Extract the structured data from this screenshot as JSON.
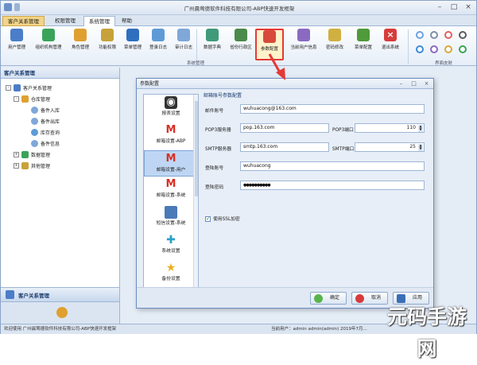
{
  "window": {
    "title": "广州晨莺德软件科技有限公司-ABP快速开发框架"
  },
  "tabs": [
    "客户关系管理",
    "权限管理",
    "系统管理",
    "帮助"
  ],
  "ribbon": {
    "buttons": [
      "用户管理",
      "组织机构管理",
      "角色管理",
      "功能权限",
      "菜单管理",
      "登录日志",
      "审计日志",
      "数据字典",
      "省份行政区",
      "参数配置",
      "当前用户信息",
      "密码修改",
      "菜单配置",
      "退出系统"
    ],
    "group_label": "系统管理",
    "skin_label": "界面皮肤"
  },
  "sidebar": {
    "header": "客户关系管理",
    "tree": [
      {
        "label": "客户关系管理",
        "level": 0,
        "expander": "-"
      },
      {
        "label": "仓库管理",
        "level": 1,
        "expander": "-"
      },
      {
        "label": "备件入库",
        "level": 2,
        "expander": ""
      },
      {
        "label": "备件出库",
        "level": 2,
        "expander": ""
      },
      {
        "label": "库存查询",
        "level": 2,
        "expander": ""
      },
      {
        "label": "备件信息",
        "level": 2,
        "expander": ""
      },
      {
        "label": "数据管理",
        "level": 1,
        "expander": "+"
      },
      {
        "label": "其他管理",
        "level": 1,
        "expander": "+"
      }
    ],
    "bottom_label": "客户关系管理"
  },
  "status": {
    "left": "欢迎使用 广州晨莺德软件科技有限公司-ABP快速开发框架",
    "right": "当前用户：admin admin(admin)     2019年7月..."
  },
  "dialog": {
    "title": "参数配置",
    "list": [
      {
        "label": "报表设置",
        "icon": "report-icon"
      },
      {
        "label": "邮箱设置-ABP",
        "icon": "gmail-icon"
      },
      {
        "label": "邮箱设置-用户",
        "icon": "gmail-icon"
      },
      {
        "label": "邮箱设置-系统",
        "icon": "gmail-icon"
      },
      {
        "label": "短信设置-系统",
        "icon": "sms-icon"
      },
      {
        "label": "系统设置",
        "icon": "puzzle-icon"
      },
      {
        "label": "备份设置",
        "icon": "star-icon"
      }
    ],
    "form": {
      "section_title": "邮箱账号参数配置",
      "email_label": "邮件账号",
      "email_value": "wuhuacong@163.com",
      "pop3_label": "POP3服务器",
      "pop3_value": "pop.163.com",
      "pop3_port_label": "POP3端口",
      "pop3_port": "110",
      "smtp_label": "SMTP服务器",
      "smtp_value": "smtp.163.com",
      "smtp_port_label": "SMTP端口",
      "smtp_port": "25",
      "login_label": "登陆账号",
      "login_value": "wuhuacong",
      "password_label": "登陆密码",
      "password_value": "●●●●●●●●●●",
      "ssl_label": "使用SSL加密",
      "ssl_checked": true
    },
    "buttons": {
      "ok": "确定",
      "cancel": "取消",
      "apply": "应用"
    }
  },
  "watermark": "元码手游网",
  "colors": {
    "accent": "#e53935",
    "ribbon_bg": "#e6eef8",
    "border": "#9fb6d6",
    "selected": "#bed6f3"
  }
}
